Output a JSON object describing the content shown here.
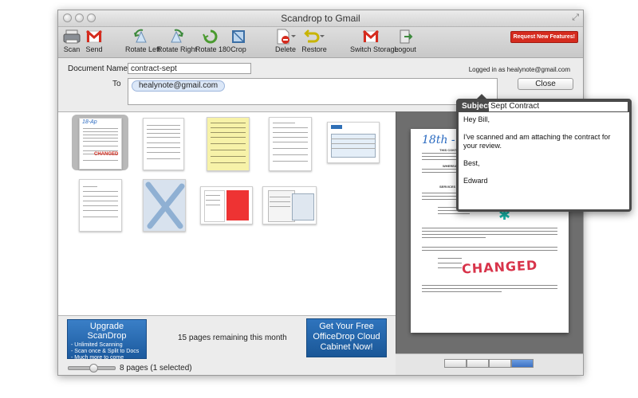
{
  "window": {
    "title": "Scandrop to Gmail"
  },
  "toolbar": {
    "items": [
      {
        "label": "Scan"
      },
      {
        "label": "Send"
      },
      {
        "label": "Rotate Left"
      },
      {
        "label": "Rotate Right"
      },
      {
        "label": "Rotate 180"
      },
      {
        "label": "Crop"
      },
      {
        "label": "Delete"
      },
      {
        "label": "Restore"
      },
      {
        "label": "Switch Storage"
      },
      {
        "label": "Logout"
      }
    ],
    "request_label": "Request New Features!"
  },
  "fields": {
    "doc_label": "Document Name",
    "doc_value": "contract-sept",
    "to_label": "To",
    "recipient": "healynote@gmail.com",
    "logged_in": "Logged in as healynote@gmail.com",
    "close_label": "Close"
  },
  "email": {
    "subject_label": "Subject:",
    "subject_value": "Sept Contract",
    "greeting": "Hey Bill,",
    "message": "I've scanned and am attaching the contract for your review.",
    "closing": "Best,",
    "signature": "Edward"
  },
  "bottom": {
    "upgrade_title": "Upgrade ScanDrop",
    "upgrade_points": [
      "- Unlimited Scanning",
      "- Scan once & Split to Docs",
      "- Much more to come"
    ],
    "remaining": "15 pages remaining this month",
    "cloud_lines": [
      "Get Your Free",
      "OfficeDrop Cloud",
      "Cabinet Now!"
    ],
    "pages_status": "8 pages (1 selected)"
  },
  "preview": {
    "handwriting_top": "18th - April",
    "handwriting_changed": "CHANGED",
    "headings": [
      "THIS CONT",
      "WHEREAS t",
      "SERVICES"
    ]
  },
  "colors": {
    "accent": "#1c5a9e",
    "brand_red": "#d52b1e",
    "token_bg": "#dce8f8"
  }
}
